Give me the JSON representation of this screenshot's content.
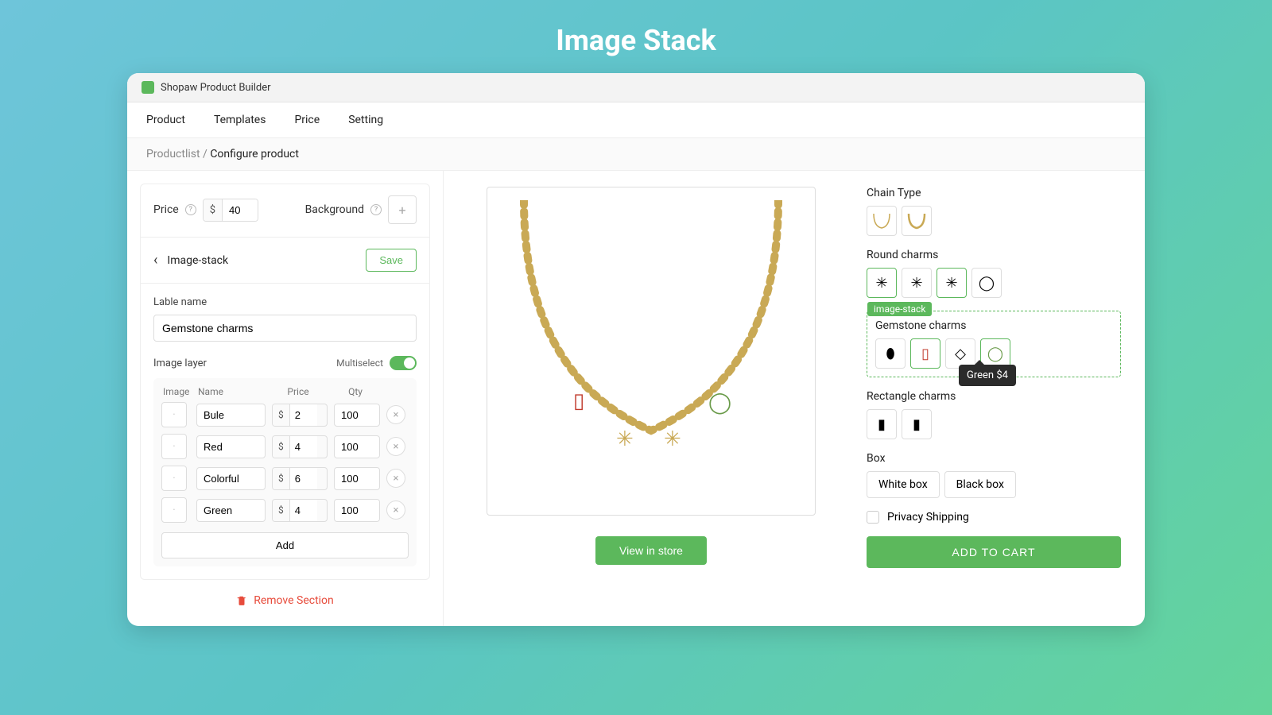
{
  "page_heading": "Image Stack",
  "app_title": "Shopaw Product Builder",
  "tabs": [
    "Product",
    "Templates",
    "Price",
    "Setting"
  ],
  "breadcrumb": {
    "root": "Productlist",
    "sep": "/",
    "current": "Configure product"
  },
  "left": {
    "price_label": "Price",
    "currency": "$",
    "price_value": "40",
    "background_label": "Background",
    "section_name": "Image-stack",
    "save": "Save",
    "label_name_label": "Lable name",
    "label_name_value": "Gemstone charms",
    "image_layer_label": "Image layer",
    "multiselect_label": "Multiselect",
    "table_headers": {
      "image": "Image",
      "name": "Name",
      "price": "Price",
      "qty": "Qty"
    },
    "rows": [
      {
        "name": "Bule",
        "price": "2",
        "qty": "100"
      },
      {
        "name": "Red",
        "price": "4",
        "qty": "100"
      },
      {
        "name": "Colorful",
        "price": "6",
        "qty": "100"
      },
      {
        "name": "Green",
        "price": "4",
        "qty": "100"
      }
    ],
    "add_label": "Add",
    "remove_section": "Remove Section"
  },
  "mid": {
    "view_in_store": "View in store"
  },
  "right": {
    "chain_type_label": "Chain Type",
    "round_charms_label": "Round charms",
    "highlight_pill": "image-stack",
    "gemstone_label": "Gemstone charms",
    "tooltip": "Green $4",
    "rectangle_label": "Rectangle charms",
    "box_label": "Box",
    "box_options": [
      "White box",
      "Black box"
    ],
    "privacy_label": "Privacy Shipping",
    "add_to_cart": "ADD TO CART"
  }
}
